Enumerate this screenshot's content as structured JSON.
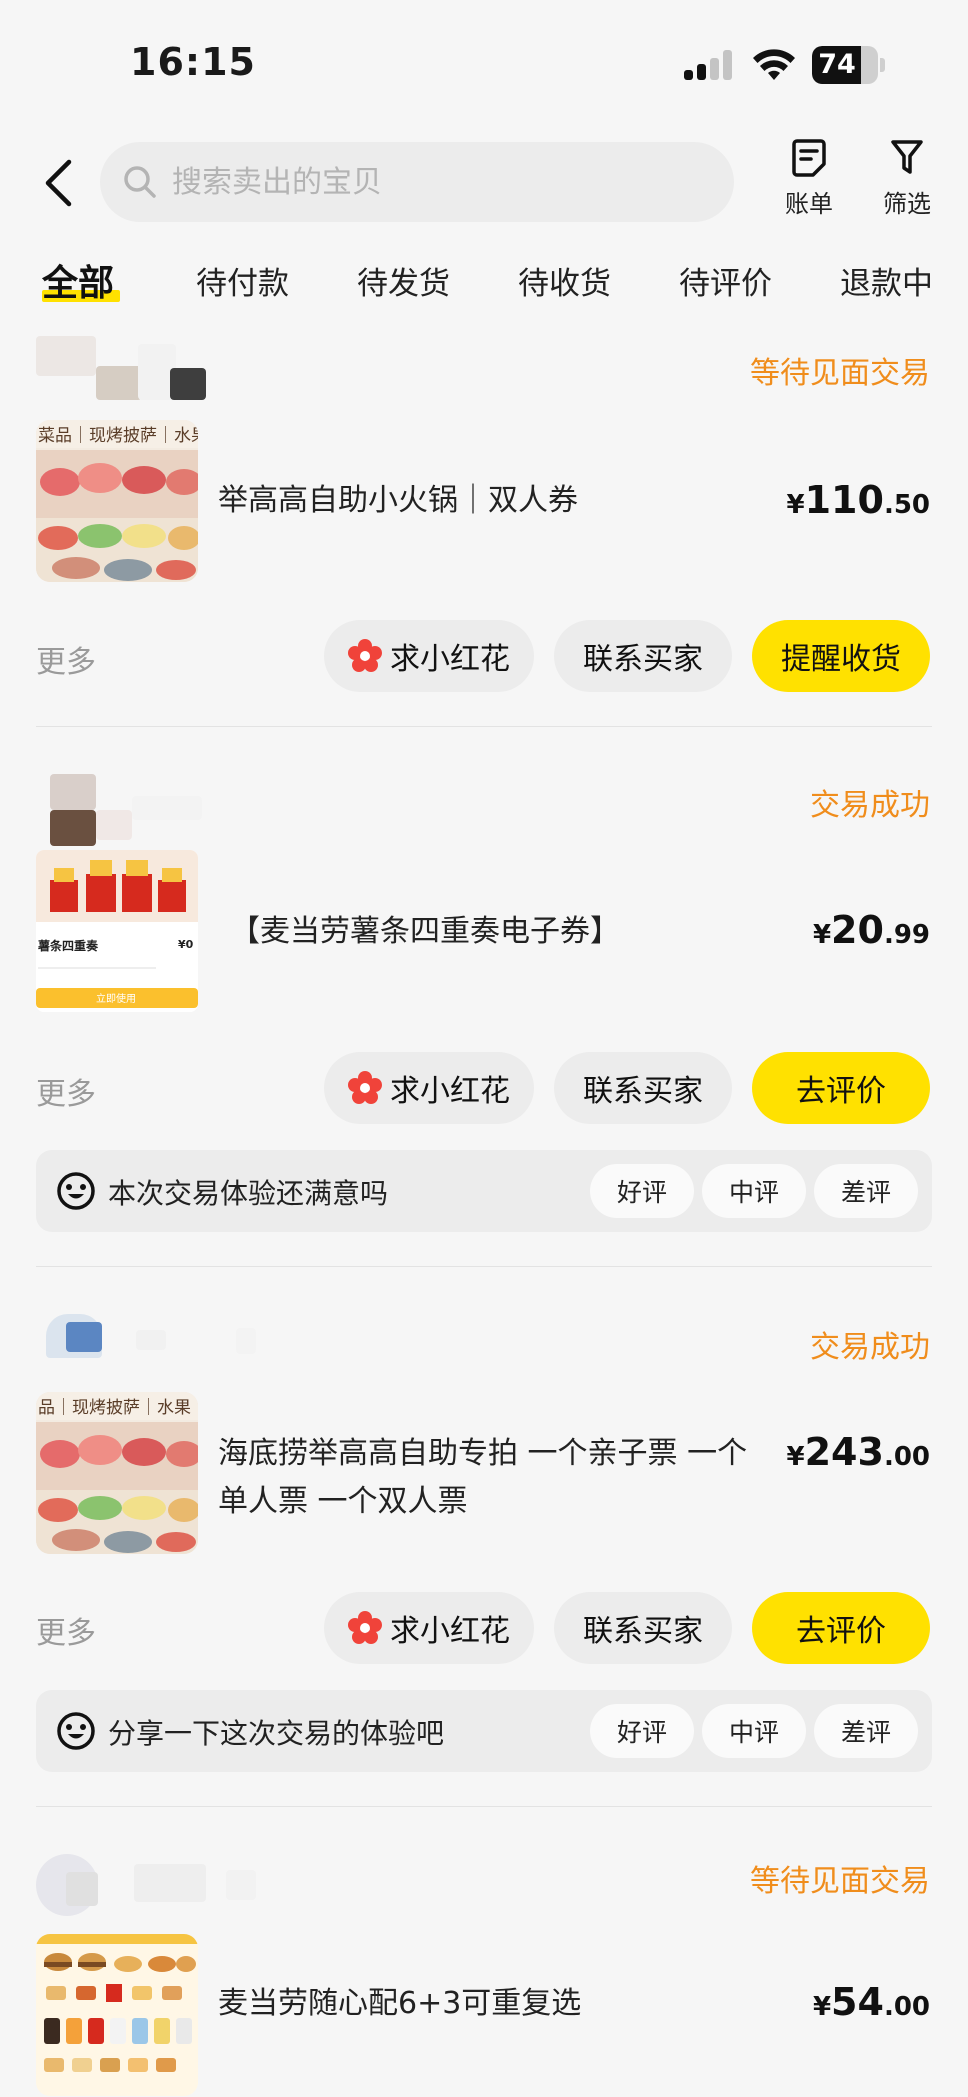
{
  "status_bar": {
    "time": "16:15",
    "battery": "74",
    "battery_level": 0.74
  },
  "header": {
    "search_placeholder": "搜索卖出的宝贝",
    "bill_label": "账单",
    "filter_label": "筛选"
  },
  "tabs": [
    {
      "label": "全部",
      "active": true
    },
    {
      "label": "待付款"
    },
    {
      "label": "待发货"
    },
    {
      "label": "待收货"
    },
    {
      "label": "待评价"
    },
    {
      "label": "退款中"
    }
  ],
  "colors": {
    "accent_yellow": "#ffe100",
    "status_orange": "#f08d1c",
    "flower_red": "#f0433a"
  },
  "orders": [
    {
      "status": "等待见面交易",
      "title": "举高高自助小火锅｜双人券",
      "price_currency": "¥",
      "price_int": "110",
      "price_dec": ".50",
      "more": "更多",
      "buttons": [
        "求小红花",
        "联系买家",
        "提醒收货"
      ]
    },
    {
      "status": "交易成功",
      "title": "【麦当劳薯条四重奏电子券】",
      "price_currency": "¥",
      "price_int": "20",
      "price_dec": ".99",
      "more": "更多",
      "buttons": [
        "求小红花",
        "联系买家",
        "去评价"
      ],
      "review_prompt": "本次交易体验还满意吗",
      "review_options": [
        "好评",
        "中评",
        "差评"
      ],
      "thumb_text": {
        "name": "薯条四重奏",
        "price": "¥0",
        "action": "立即使用"
      }
    },
    {
      "status": "交易成功",
      "title_line1": "海底捞举高高自助专拍 一个亲子票 一个",
      "title_line2": "单人票 一个双人票",
      "price_currency": "¥",
      "price_int": "243",
      "price_dec": ".00",
      "more": "更多",
      "buttons": [
        "求小红花",
        "联系买家",
        "去评价"
      ],
      "review_prompt": "分享一下这次交易的体验吧",
      "review_options": [
        "好评",
        "中评",
        "差评"
      ],
      "thumb_text": "品｜现烤披萨｜水果"
    },
    {
      "status": "等待见面交易",
      "title": "麦当劳随心配6+3可重复选",
      "price_currency": "¥",
      "price_int": "54",
      "price_dec": ".00"
    }
  ],
  "thumb1_text": "菜品｜现烤披萨｜水果"
}
